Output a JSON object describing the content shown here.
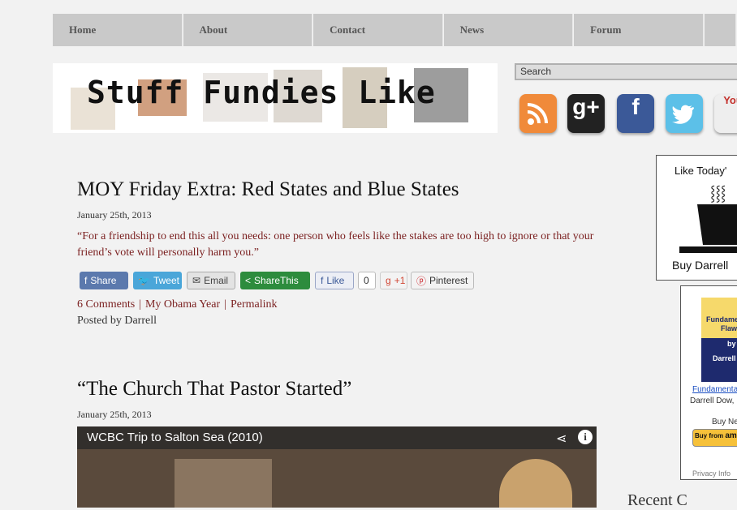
{
  "nav": {
    "items": [
      "Home",
      "About",
      "Contact",
      "News",
      "Forum"
    ]
  },
  "site": {
    "title": "Stuff Fundies Like"
  },
  "search": {
    "placeholder": "Search"
  },
  "social": {
    "icons": [
      "rss-icon",
      "google-plus-icon",
      "facebook-icon",
      "twitter-icon",
      "youtube-icon"
    ],
    "colors": {
      "rss": "#f08a3a",
      "gplus": "#222222",
      "facebook": "#3b5998",
      "twitter": "#5cc0e8",
      "youtube": "#c4302b"
    },
    "gplus_label": "g+",
    "facebook_label": "f",
    "youtube_label": "You"
  },
  "post1": {
    "title": "MOY Friday Extra: Red States and Blue States",
    "date": "January 25th, 2013",
    "quote": "“For a friendship to end this all you needs: one person who feels like the stakes are too high to ignore or that your friend’s vote will personally harm you.”",
    "share": {
      "share": "Share",
      "tweet": "Tweet",
      "email": "Email",
      "sharethis": "ShareThis",
      "like": "Like",
      "like_count": "0",
      "plus1": "+1",
      "pinterest": "Pinterest"
    },
    "comments": "6 Comments",
    "category": "My Obama Year",
    "permalink": "Permalink",
    "posted_by": "Posted by Darrell"
  },
  "post2": {
    "title": "“The Church That Pastor Started”",
    "date": "January 25th, 2013",
    "video_title": "WCBC Trip to Salton Sea (2010)"
  },
  "sidebar": {
    "widget1_title": "Like Today'",
    "widget1_footer": "Buy Darrell",
    "book_line1": "Fundame",
    "book_line2": "Flaw",
    "book_line3": "by",
    "book_line4": "Darrell",
    "book_link": "Fundamenta",
    "book_author": "Darrell Dow,",
    "buy_new": "Buy Ne",
    "buy_from": "Buy from",
    "amazon": "amazo",
    "privacy": "Privacy Info",
    "recent_heading": "Recent C"
  }
}
